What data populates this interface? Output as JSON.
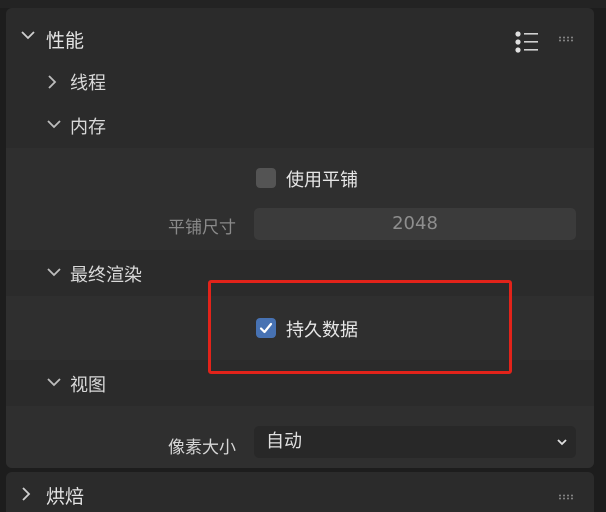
{
  "performance": {
    "title": "性能",
    "threads": {
      "label": "线程"
    },
    "memory": {
      "label": "内存",
      "use_tiling": {
        "label": "使用平铺",
        "checked": false
      },
      "tile_size": {
        "label": "平铺尺寸",
        "value": "2048"
      }
    },
    "final_render": {
      "label": "最终渲染",
      "persistent_data": {
        "label": "持久数据",
        "checked": true
      }
    },
    "viewport": {
      "label": "视图",
      "pixel_size": {
        "label": "像素大小",
        "value": "自动"
      }
    }
  },
  "bake": {
    "title": "烘焙"
  },
  "colors": {
    "accent": "#4772b3",
    "highlight": "#e2231a"
  }
}
